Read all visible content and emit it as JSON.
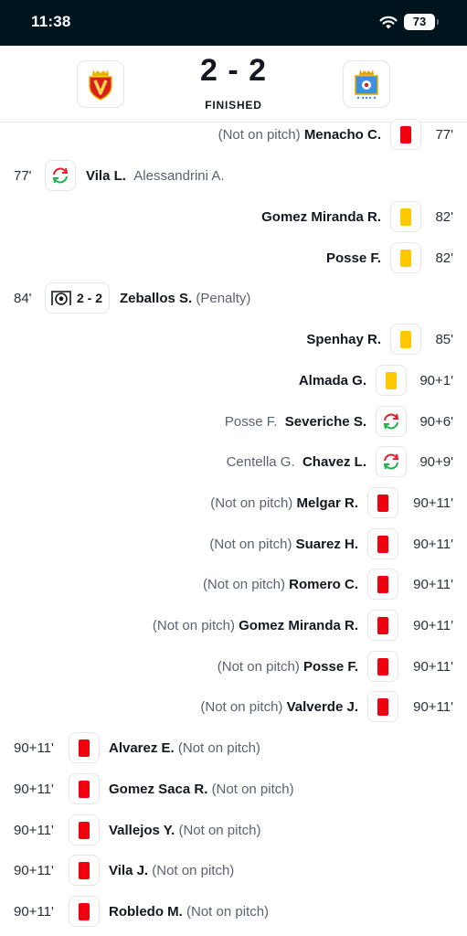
{
  "status_bar": {
    "time": "11:38",
    "battery": "73"
  },
  "match": {
    "score": "2 - 2",
    "status": "FINISHED",
    "home_crest": "home-team-crest",
    "away_crest": "away-team-crest"
  },
  "colors": {
    "red_card": "#f0000f",
    "yellow_card": "#ffc800",
    "sub_green": "#1fb24a",
    "sub_red": "#e5202e"
  },
  "events": [
    {
      "side": "right",
      "type": "red-card",
      "minute": "77'",
      "player": "Menacho C.",
      "note": "(Not on pitch)"
    },
    {
      "side": "left",
      "type": "substitution",
      "minute": "77'",
      "player": "Vila L.",
      "note": "Alessandrini A."
    },
    {
      "side": "right",
      "type": "yellow-card",
      "minute": "82'",
      "player": "Gomez Miranda R.",
      "note": ""
    },
    {
      "side": "right",
      "type": "yellow-card",
      "minute": "82'",
      "player": "Posse F.",
      "note": ""
    },
    {
      "side": "left",
      "type": "goal",
      "minute": "84'",
      "score": "2 - 2",
      "player": "Zeballos S.",
      "note": "(Penalty)"
    },
    {
      "side": "right",
      "type": "yellow-card",
      "minute": "85'",
      "player": "Spenhay R.",
      "note": ""
    },
    {
      "side": "right",
      "type": "yellow-card",
      "minute": "90+1'",
      "player": "Almada G.",
      "note": ""
    },
    {
      "side": "right",
      "type": "substitution",
      "minute": "90+6'",
      "player": "Severiche S.",
      "note": "Posse F."
    },
    {
      "side": "right",
      "type": "substitution",
      "minute": "90+9'",
      "player": "Chavez L.",
      "note": "Centella G."
    },
    {
      "side": "right",
      "type": "red-card",
      "minute": "90+11'",
      "player": "Melgar R.",
      "note": "(Not on pitch)"
    },
    {
      "side": "right",
      "type": "red-card",
      "minute": "90+11'",
      "player": "Suarez H.",
      "note": "(Not on pitch)"
    },
    {
      "side": "right",
      "type": "red-card",
      "minute": "90+11'",
      "player": "Romero C.",
      "note": "(Not on pitch)"
    },
    {
      "side": "right",
      "type": "red-card",
      "minute": "90+11'",
      "player": "Gomez Miranda R.",
      "note": "(Not on pitch)"
    },
    {
      "side": "right",
      "type": "red-card",
      "minute": "90+11'",
      "player": "Posse F.",
      "note": "(Not on pitch)"
    },
    {
      "side": "right",
      "type": "red-card",
      "minute": "90+11'",
      "player": "Valverde J.",
      "note": "(Not on pitch)"
    },
    {
      "side": "left",
      "type": "red-card",
      "minute": "90+11'",
      "player": "Alvarez E.",
      "note": "(Not on pitch)"
    },
    {
      "side": "left",
      "type": "red-card",
      "minute": "90+11'",
      "player": "Gomez Saca R.",
      "note": "(Not on pitch)"
    },
    {
      "side": "left",
      "type": "red-card",
      "minute": "90+11'",
      "player": "Vallejos Y.",
      "note": "(Not on pitch)"
    },
    {
      "side": "left",
      "type": "red-card",
      "minute": "90+11'",
      "player": "Vila J.",
      "note": "(Not on pitch)"
    },
    {
      "side": "left",
      "type": "red-card",
      "minute": "90+11'",
      "player": "Robledo M.",
      "note": "(Not on pitch)"
    }
  ]
}
